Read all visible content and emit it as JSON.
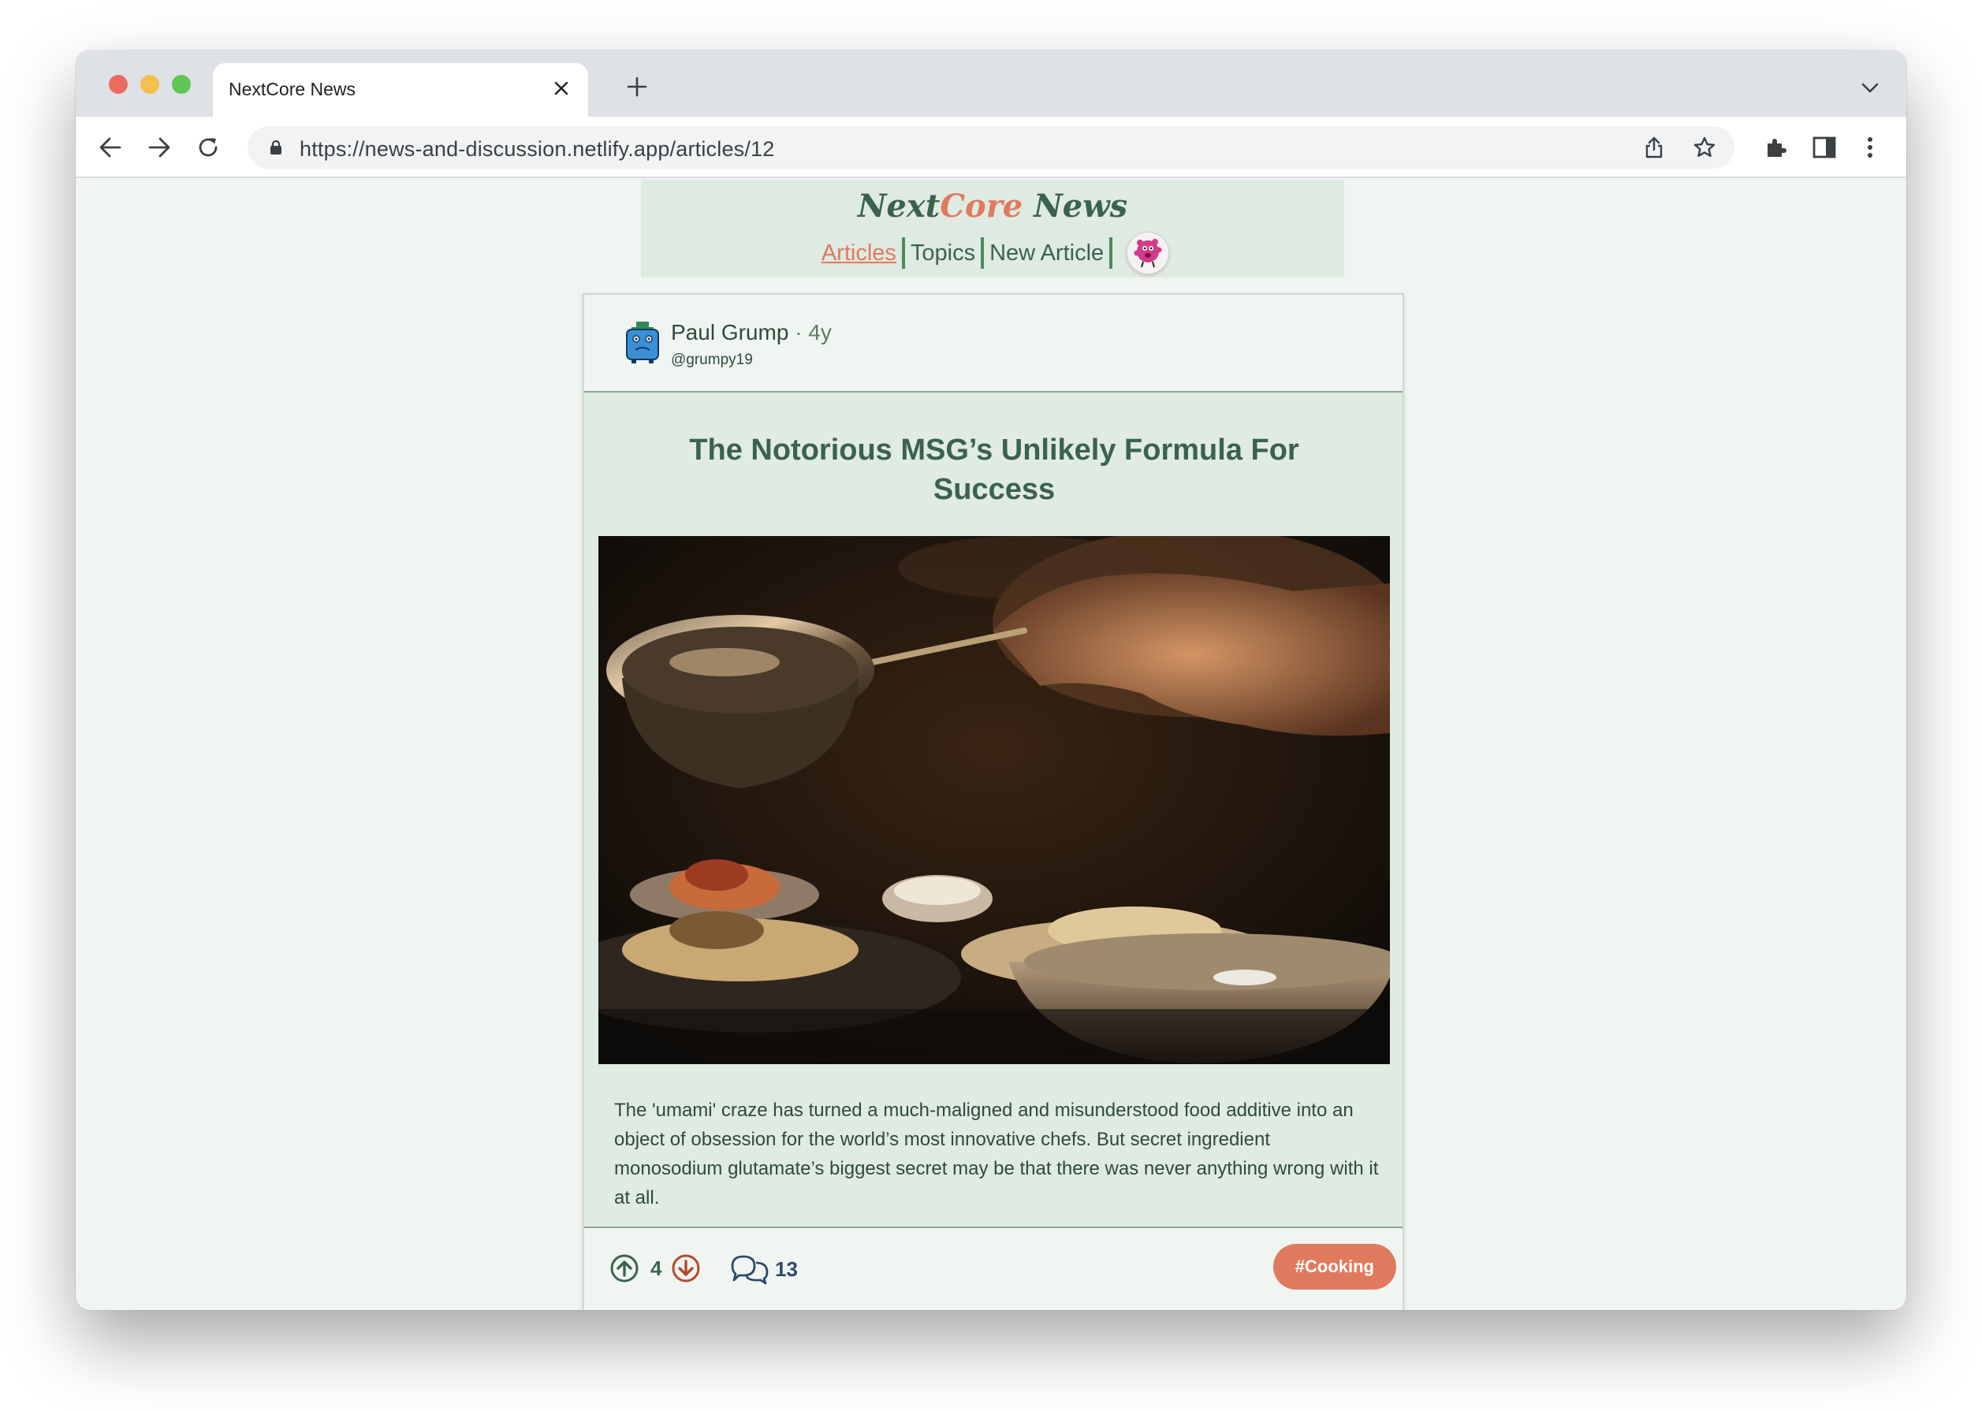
{
  "browser": {
    "tab_title": "NextCore News",
    "url": "https://news-and-discussion.netlify.app/articles/12"
  },
  "site": {
    "brand_part1": "Next",
    "brand_part2": "Core",
    "brand_part3": " News",
    "nav": {
      "articles": "Articles",
      "topics": "Topics",
      "new_article": "New Article"
    }
  },
  "article": {
    "author_name": "Paul Grump",
    "time_ago": "· 4y",
    "author_handle": "@grumpy19",
    "title": "The Notorious MSG’s Unlikely Formula For Success",
    "summary": "The 'umami' craze has turned a much-maligned and misunderstood food additive into an object of obsession for the world’s most innovative chefs. But secret ingredient monosodium glutamate’s biggest secret may be that there was never anything wrong with it at all.",
    "votes": "4",
    "comments": "13",
    "topic_tag": "#Cooking"
  },
  "colors": {
    "accent": "#e07a5f",
    "primary": "#3b6250",
    "card_bg": "#e0ebe3",
    "page_bg": "#f1f5f2"
  },
  "icons": [
    "back-icon",
    "forward-icon",
    "reload-icon",
    "lock-icon",
    "share-icon",
    "star-icon",
    "extensions-icon",
    "side-panel-icon",
    "menu-icon",
    "upvote-icon",
    "downvote-icon",
    "comments-icon"
  ]
}
